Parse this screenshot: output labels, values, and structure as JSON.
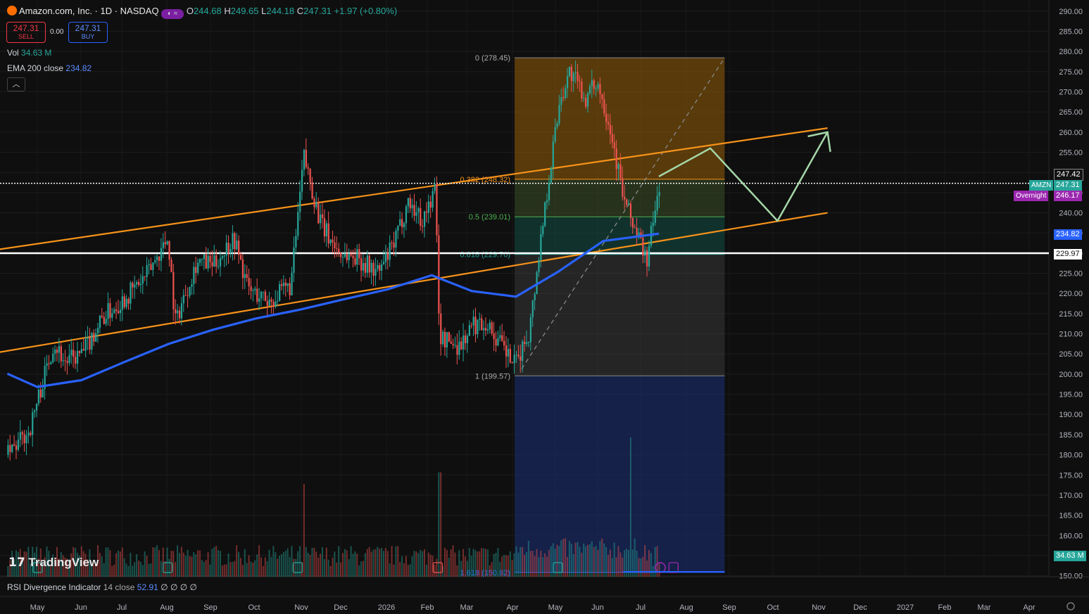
{
  "header": {
    "title": "Amazon.com, Inc. · 1D · NASDAQ",
    "open_label": "O",
    "open": "244.68",
    "high_label": "H",
    "high": "249.65",
    "low_label": "L",
    "low": "244.18",
    "close_label": "C",
    "close": "247.31",
    "change": "+1.97 (+0.80%)",
    "sell_price": "247.31",
    "sell_label": "SELL",
    "buy_price": "247.31",
    "buy_label": "BUY",
    "spread": "0.00",
    "vol_label": "Vol",
    "vol_value": "34.63 M",
    "ema_label": "EMA 200 close",
    "ema_value": "234.82"
  },
  "branding": {
    "logo_text": "TradingView"
  },
  "rsi": {
    "label": "RSI Divergence Indicator",
    "params": "14 close",
    "value": "52.91",
    "extra": "∅ ∅ ∅ ∅"
  },
  "price_tags": {
    "high_tag": "247.42",
    "symbol": "AMZN",
    "last": "247.31",
    "overnight_label": "Overnight",
    "overnight": "246.17",
    "ema": "234.82",
    "level": "229.97",
    "volume": "34.63 M"
  },
  "colors": {
    "up": "#26a69a",
    "down": "#ef5350",
    "channel": "#f7931a",
    "ema": "#2962ff",
    "projection": "#a5d6a7",
    "background": "#0f0f0f"
  },
  "chart_data": {
    "type": "candlestick",
    "symbol": "AMZN",
    "timeframe": "1D",
    "y_axis": {
      "ylim": [
        150,
        290
      ],
      "ticks": [
        "290.00",
        "285.00",
        "280.00",
        "275.00",
        "270.00",
        "265.00",
        "260.00",
        "255.00",
        "250.00",
        "245.00",
        "240.00",
        "235.00",
        "230.00",
        "225.00",
        "220.00",
        "215.00",
        "210.00",
        "205.00",
        "200.00",
        "195.00",
        "190.00",
        "185.00",
        "180.00",
        "175.00",
        "170.00",
        "165.00",
        "160.00",
        "155.00",
        "150.00"
      ]
    },
    "x_axis": {
      "ticks": [
        "May",
        "Jun",
        "Jul",
        "Aug",
        "Sep",
        "Oct",
        "Nov",
        "Dec",
        "2026",
        "Feb",
        "Mar",
        "Apr",
        "May",
        "Jun",
        "Jul",
        "Aug",
        "Sep",
        "Oct",
        "Nov",
        "Dec",
        "2027",
        "Feb",
        "Mar",
        "Apr"
      ]
    },
    "fib_levels": [
      {
        "label": "0 (278.45)",
        "value": 278.45
      },
      {
        "label": "0.382 (248.32)",
        "value": 248.32
      },
      {
        "label": "0.5 (239.01)",
        "value": 239.01
      },
      {
        "label": "0.618 (229.70)",
        "value": 229.7
      },
      {
        "label": "1 (199.57)",
        "value": 199.57
      },
      {
        "label": "1.618 (150.82)",
        "value": 150.82
      }
    ],
    "horizontal_levels": [
      247.31,
      229.97
    ],
    "channel_upper": [
      [
        "2025-04-15",
        229.7
      ],
      [
        "2026-11-05",
        261
      ]
    ],
    "channel_lower": [
      [
        "2025-04-15",
        204
      ],
      [
        "2026-11-05",
        240
      ]
    ],
    "ema_200": [
      [
        "2025-04-10",
        200.1
      ],
      [
        "2025-05-01",
        196.8
      ],
      [
        "2025-06-01",
        198.5
      ],
      [
        "2025-07-01",
        203
      ],
      [
        "2025-08-01",
        207.5
      ],
      [
        "2025-09-01",
        211
      ],
      [
        "2025-10-01",
        213.8
      ],
      [
        "2025-11-01",
        216
      ],
      [
        "2025-12-01",
        218.5
      ],
      [
        "2026-01-01",
        221
      ],
      [
        "2026-02-01",
        224.5
      ],
      [
        "2026-03-01",
        220.6
      ],
      [
        "2026-04-01",
        219.2
      ],
      [
        "2026-05-01",
        225.5
      ],
      [
        "2026-06-01",
        233
      ],
      [
        "2026-07-10",
        234.82
      ]
    ],
    "close_path": [
      [
        "2025-04-10",
        180
      ],
      [
        "2025-04-25",
        186
      ],
      [
        "2025-05-01",
        194
      ],
      [
        "2025-05-12",
        208
      ],
      [
        "2025-05-20",
        203
      ],
      [
        "2025-06-01",
        205
      ],
      [
        "2025-06-15",
        214
      ],
      [
        "2025-07-01",
        219
      ],
      [
        "2025-07-15",
        224
      ],
      [
        "2025-07-31",
        234
      ],
      [
        "2025-08-05",
        213
      ],
      [
        "2025-08-20",
        228
      ],
      [
        "2025-09-01",
        227
      ],
      [
        "2025-09-15",
        234
      ],
      [
        "2025-09-25",
        221
      ],
      [
        "2025-10-10",
        218
      ],
      [
        "2025-10-25",
        222
      ],
      [
        "2025-11-03",
        254
      ],
      [
        "2025-11-15",
        237
      ],
      [
        "2025-11-28",
        230
      ],
      [
        "2025-12-10",
        229
      ],
      [
        "2025-12-25",
        225
      ],
      [
        "2026-01-05",
        232
      ],
      [
        "2026-01-15",
        243
      ],
      [
        "2026-01-25",
        238
      ],
      [
        "2026-02-03",
        246
      ],
      [
        "2026-02-06",
        209
      ],
      [
        "2026-02-20",
        207
      ],
      [
        "2026-03-01",
        212
      ],
      [
        "2026-03-10",
        213
      ],
      [
        "2026-03-25",
        205
      ],
      [
        "2026-03-31",
        202
      ],
      [
        "2026-04-10",
        211
      ],
      [
        "2026-04-20",
        240
      ],
      [
        "2026-05-01",
        268
      ],
      [
        "2026-05-08",
        275
      ],
      [
        "2026-05-20",
        268
      ],
      [
        "2026-05-27",
        273
      ],
      [
        "2026-06-05",
        262
      ],
      [
        "2026-06-15",
        243
      ],
      [
        "2026-06-25",
        234
      ],
      [
        "2026-07-01",
        228
      ],
      [
        "2026-07-08",
        243
      ],
      [
        "2026-07-10",
        247.31
      ]
    ],
    "projection_path": [
      [
        "2026-07-10",
        249
      ],
      [
        "2026-08-15",
        256
      ],
      [
        "2026-10-01",
        238
      ],
      [
        "2026-11-05",
        260
      ]
    ],
    "volume_spikes": [
      [
        "2025-11-03",
        24
      ],
      [
        "2026-02-06",
        27
      ],
      [
        "2026-06-20",
        36
      ]
    ]
  }
}
